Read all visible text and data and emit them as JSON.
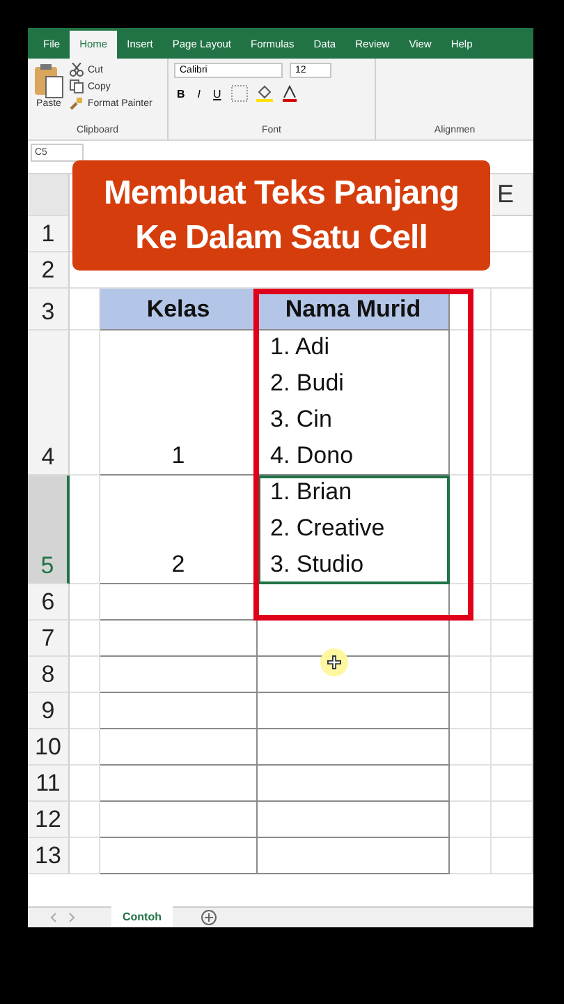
{
  "ribbon": {
    "tabs": [
      {
        "label": "File",
        "selected": false
      },
      {
        "label": "Home",
        "selected": true
      },
      {
        "label": "Insert",
        "selected": false
      },
      {
        "label": "Page Layout",
        "selected": false
      },
      {
        "label": "Formulas",
        "selected": false
      },
      {
        "label": "Data",
        "selected": false
      },
      {
        "label": "Review",
        "selected": false
      },
      {
        "label": "View",
        "selected": false
      },
      {
        "label": "Help",
        "selected": false
      }
    ],
    "clipboard": {
      "paste": "Paste",
      "cut": "Cut",
      "copy": "Copy",
      "format_painter": "Format Painter",
      "label": "Clipboard"
    },
    "font": {
      "family": "Calibri",
      "size": "12",
      "bold": "B",
      "italic": "I",
      "underline": "U",
      "label": "Font"
    },
    "alignment": {
      "label": "Alignmen"
    }
  },
  "name_box": "C5",
  "banner": {
    "lines": [
      "Membuat Teks Panjang",
      "Ke Dalam Satu Cell"
    ]
  },
  "column_header": "E",
  "rows": [
    {
      "number": "1",
      "selected": false
    },
    {
      "number": "2",
      "selected": false
    },
    {
      "number": "3",
      "selected": false,
      "header": true,
      "b": "Kelas",
      "c": "Nama Murid"
    },
    {
      "number": "4",
      "selected": false,
      "b": "1",
      "c": "1. Adi\n2. Budi\n3. Cin\n4. Dono"
    },
    {
      "number": "5",
      "selected": true,
      "b": "2",
      "c": "1. Brian\n2. Creative\n3. Studio"
    },
    {
      "number": "6",
      "selected": false
    },
    {
      "number": "7",
      "selected": false
    },
    {
      "number": "8",
      "selected": false
    },
    {
      "number": "9",
      "selected": false
    },
    {
      "number": "10",
      "selected": false
    },
    {
      "number": "11",
      "selected": false
    },
    {
      "number": "12",
      "selected": false
    },
    {
      "number": "13",
      "selected": false
    }
  ],
  "sheet_tabs": [
    {
      "label": "Contoh",
      "selected": true
    }
  ]
}
